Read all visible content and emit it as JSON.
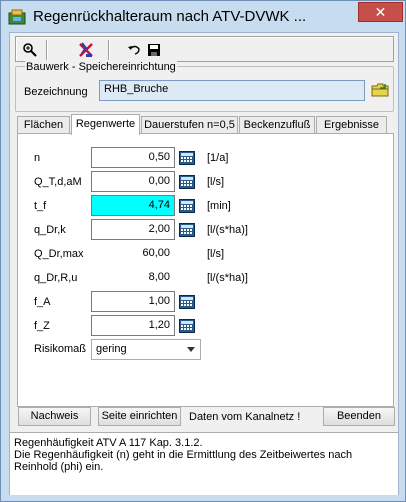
{
  "window": {
    "title": "Regenrückhalteraum nach ATV-DVWK ...",
    "close_label": "✕"
  },
  "toolbar": {
    "icons": [
      "magnifier-icon",
      "cross-out-icon",
      "undo-icon",
      "save-icon"
    ]
  },
  "bauwerk": {
    "group_title": "Bauwerk - Speichereinrichtung",
    "label": "Bezeichnung",
    "value": "RHB_Bruche"
  },
  "tabs": [
    {
      "label": "Flächen",
      "active": false
    },
    {
      "label": "Regenwerte",
      "active": true
    },
    {
      "label": "Dauerstufen n=0,5",
      "active": false
    },
    {
      "label": "Beckenzufluß",
      "active": false
    },
    {
      "label": "Ergebnisse",
      "active": false
    }
  ],
  "params": [
    {
      "label": "n",
      "value": "0,50",
      "unit": "[1/a]",
      "editable": true
    },
    {
      "label": "Q_T,d,aM",
      "value": "0,00",
      "unit": "[l/s]",
      "editable": true
    },
    {
      "label": "t_f",
      "value": "4,74",
      "unit": "[min]",
      "editable": true,
      "highlight": "#00ffff"
    },
    {
      "label": "q_Dr,k",
      "value": "2,00",
      "unit": "[l/(s*ha)]",
      "editable": true
    },
    {
      "label": "Q_Dr,max",
      "value": "60,00",
      "unit": "[l/s]",
      "editable": false
    },
    {
      "label": "q_Dr,R,u",
      "value": "8,00",
      "unit": "[l/(s*ha)]",
      "editable": false
    },
    {
      "label": "f_A",
      "value": "1,00",
      "unit": "",
      "editable": true
    },
    {
      "label": "f_Z",
      "value": "1,20",
      "unit": "",
      "editable": true
    }
  ],
  "risiko": {
    "label": "Risikomaß",
    "selected": "gering"
  },
  "buttons": {
    "nachweis": "Nachweis",
    "seite": "Seite einrichten",
    "beenden": "Beenden"
  },
  "status": "Daten vom Kanalnetz !",
  "info": {
    "line1": "Regenhäufigkeit ATV A 117 Kap. 3.1.2.",
    "line2": "Die Regenhäufigkeit (n) geht in die Ermittlung des Zeitbeiwertes nach Reinhold (phi) ein."
  },
  "colors": {
    "highlight": "#00ffff",
    "title_bg": "#c8dcf0",
    "close_bg": "#c74f4a"
  }
}
